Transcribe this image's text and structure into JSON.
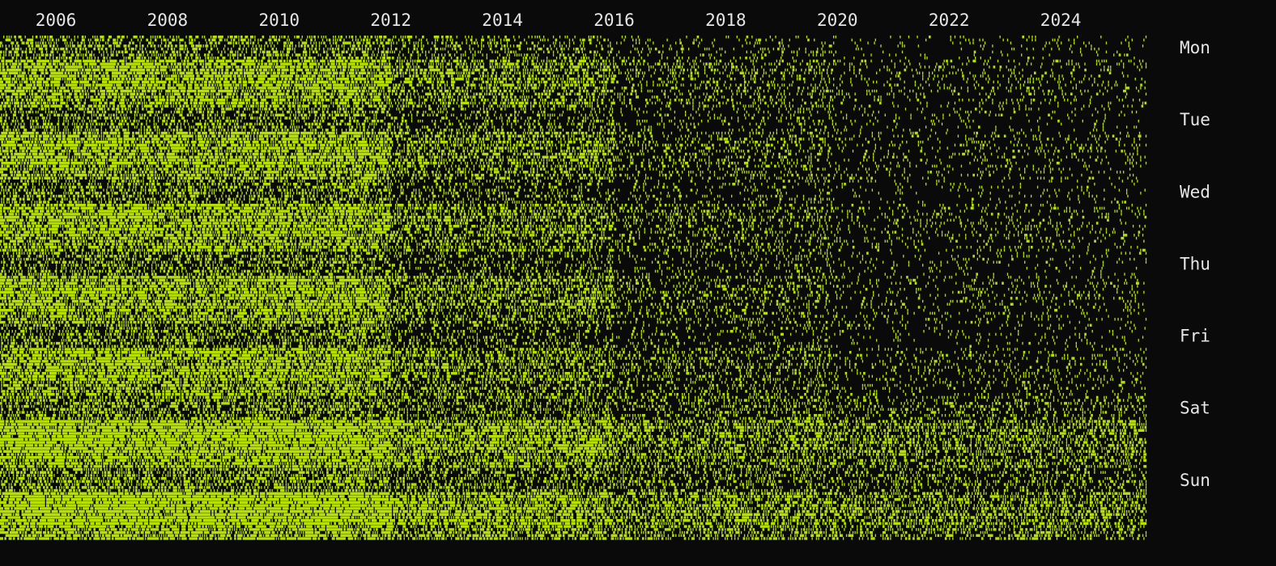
{
  "colors": {
    "background": "#0a0a0a",
    "mark": "#b7e000",
    "text": "#e6e6e6"
  },
  "chart_data": {
    "type": "heatmap",
    "title": "",
    "xlabel": "",
    "ylabel": "",
    "x_axis_position": "top",
    "y_axis_position": "right",
    "grid": false,
    "legend": "none",
    "x_range": [
      2005,
      2026
    ],
    "x_ticks": [
      "2006",
      "2008",
      "2010",
      "2012",
      "2014",
      "2016",
      "2018",
      "2020",
      "2022",
      "2024"
    ],
    "y_ticks": [
      "Mon",
      "Tue",
      "Wed",
      "Thu",
      "Fri",
      "Sat",
      "Sun"
    ],
    "y_ticks_hours_per_day": 24,
    "estimated_activity_density": [
      {
        "day": "Mon",
        "y2005_2011": 0.72,
        "y2012_2015": 0.45,
        "y2016_2019": 0.22,
        "y2020_2025": 0.12
      },
      {
        "day": "Tue",
        "y2005_2011": 0.7,
        "y2012_2015": 0.42,
        "y2016_2019": 0.22,
        "y2020_2025": 0.12
      },
      {
        "day": "Wed",
        "y2005_2011": 0.7,
        "y2012_2015": 0.42,
        "y2016_2019": 0.22,
        "y2020_2025": 0.12
      },
      {
        "day": "Thu",
        "y2005_2011": 0.7,
        "y2012_2015": 0.42,
        "y2016_2019": 0.22,
        "y2020_2025": 0.12
      },
      {
        "day": "Fri",
        "y2005_2011": 0.7,
        "y2012_2015": 0.42,
        "y2016_2019": 0.24,
        "y2020_2025": 0.13
      },
      {
        "day": "Sat",
        "y2005_2011": 0.82,
        "y2012_2015": 0.6,
        "y2016_2019": 0.45,
        "y2020_2025": 0.4
      },
      {
        "day": "Sun",
        "y2005_2011": 0.85,
        "y2012_2015": 0.65,
        "y2016_2019": 0.5,
        "y2020_2025": 0.42
      }
    ]
  }
}
